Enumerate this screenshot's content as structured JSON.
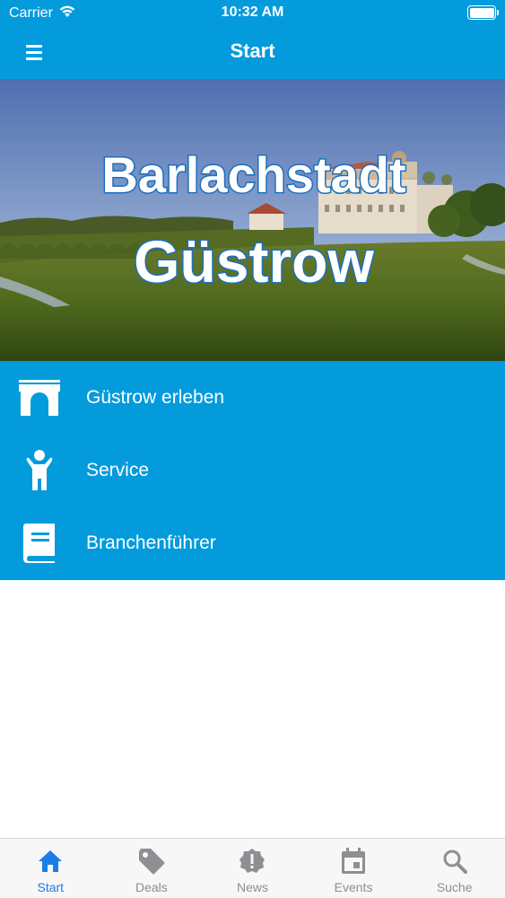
{
  "status_bar": {
    "carrier": "Carrier",
    "time": "10:32 AM"
  },
  "nav": {
    "title": "Start",
    "menu_icon": "hamburger-menu-icon"
  },
  "hero": {
    "line1": "Barlachstadt",
    "line2": "Güstrow"
  },
  "menu": {
    "items": [
      {
        "label": "Güstrow erleben",
        "icon": "archway-icon"
      },
      {
        "label": "Service",
        "icon": "person-icon"
      },
      {
        "label": "Branchenführer",
        "icon": "book-icon"
      }
    ]
  },
  "tabbar": {
    "tabs": [
      {
        "label": "Start",
        "icon": "home-icon",
        "active": true
      },
      {
        "label": "Deals",
        "icon": "tag-icon",
        "active": false
      },
      {
        "label": "News",
        "icon": "badge-alert-icon",
        "active": false
      },
      {
        "label": "Events",
        "icon": "calendar-icon",
        "active": false
      },
      {
        "label": "Suche",
        "icon": "search-icon",
        "active": false
      }
    ]
  },
  "colors": {
    "primary": "#049bdd",
    "tab_active": "#1a7ee6",
    "tab_inactive": "#8e8e93"
  }
}
